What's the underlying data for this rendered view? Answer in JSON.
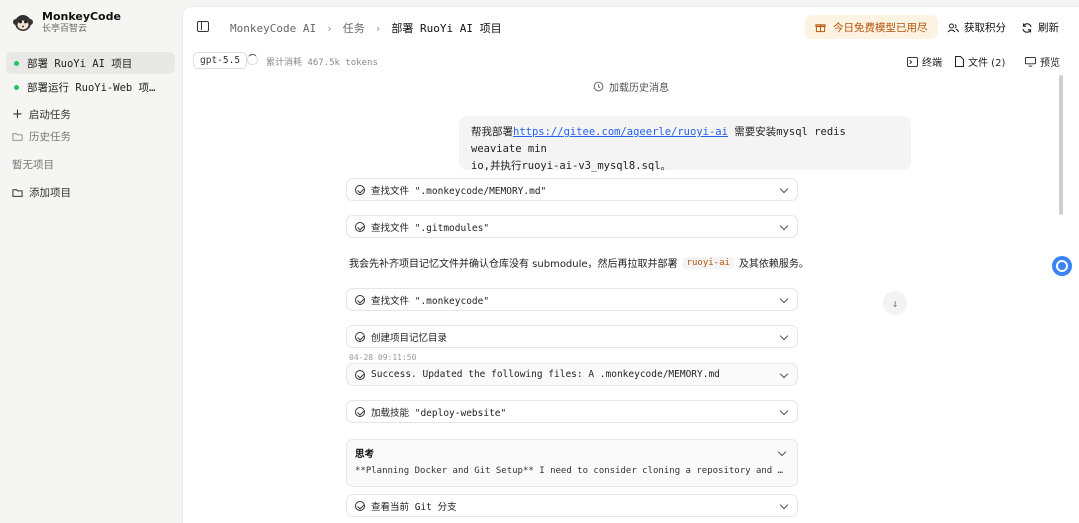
{
  "brand": {
    "name": "MonkeyCode",
    "subtitle": "长亭百智云"
  },
  "sidebar": {
    "tasks": [
      {
        "label": "部署 RuoYi AI 项目",
        "active": true
      },
      {
        "label": "部署运行 RuoYi-Web 项…",
        "active": false
      }
    ],
    "start_task": "启动任务",
    "history_tasks": "历史任务",
    "no_projects": "暂无项目",
    "add_project": "添加项目"
  },
  "breadcrumb": {
    "root": "MonkeyCode AI",
    "section": "任务",
    "current": "部署 RuoYi AI 项目"
  },
  "header": {
    "free_badge": "今日免费模型已用尽",
    "get_points": "获取积分",
    "refresh": "刷新"
  },
  "subbar": {
    "model": "gpt-5.5",
    "tokens_label": "累计消耗 467.5k tokens",
    "terminal": "终端",
    "files": "文件 (2)",
    "preview": "预览"
  },
  "chat": {
    "load_history": "加载历史消息",
    "user_message": {
      "prefix": "帮我部署",
      "link": "https://gitee.com/ageerle/ruoyi-ai",
      "suffix_line1": " 需要安装mysql redis weaviate min",
      "line2": "io,并执行ruoyi-ai-v3_mysql8.sql。"
    },
    "cards": [
      {
        "label": "查找文件 \".monkeycode/MEMORY.md\""
      },
      {
        "label": "查找文件 \".gitmodules\""
      },
      {
        "label": "查找文件 \".monkeycode\""
      },
      {
        "label": "创建项目记忆目录"
      },
      {
        "label": "Success. Updated the following files: A .monkeycode/MEMORY.md"
      },
      {
        "label": "加载技能 \"deploy-website\""
      },
      {
        "label": "查看当前 Git 分支"
      }
    ],
    "assistant_text": {
      "before": "我会先补齐项目记忆文件并确认仓库没有 submodule，然后再拉取并部署",
      "code": "ruoyi-ai",
      "after": "及其依赖服务。"
    },
    "timestamp": "04-28 09:11:50",
    "thinking": {
      "title": "思考",
      "body": "**Planning Docker and Git Setup** I need to consider cloning a repository and potentially setting up Docker services for deployment"
    }
  },
  "colors": {
    "accent": "#2563eb",
    "badge_bg": "#fdf3e3",
    "badge_text": "#b45309",
    "active_dot": "#22c55e"
  }
}
